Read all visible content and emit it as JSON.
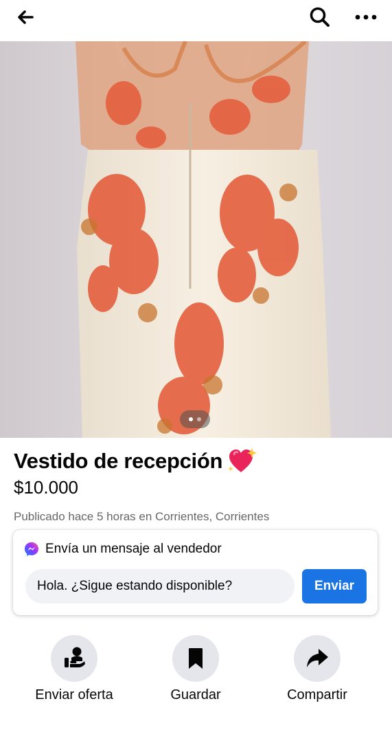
{
  "header": {
    "back_icon": "back-arrow-icon",
    "search_icon": "search-icon",
    "more_icon": "more-dots-icon"
  },
  "listing": {
    "title": "Vestido de recepción",
    "title_emoji": "sparkling-heart-emoji",
    "price": "$10.000",
    "posted": "Publicado hace 5 horas en Corrientes, Corrientes",
    "photo_count": 2,
    "photo_index": 1
  },
  "message_box": {
    "heading": "Envía un mensaje al vendedor",
    "input_value": "Hola. ¿Sigue estando disponible?",
    "send_label": "Enviar",
    "accent": "#1b74e4"
  },
  "actions": [
    {
      "label": "Enviar oferta",
      "icon": "offer-person-icon"
    },
    {
      "label": "Guardar",
      "icon": "bookmark-icon"
    },
    {
      "label": "Compartir",
      "icon": "share-arrow-icon"
    }
  ]
}
